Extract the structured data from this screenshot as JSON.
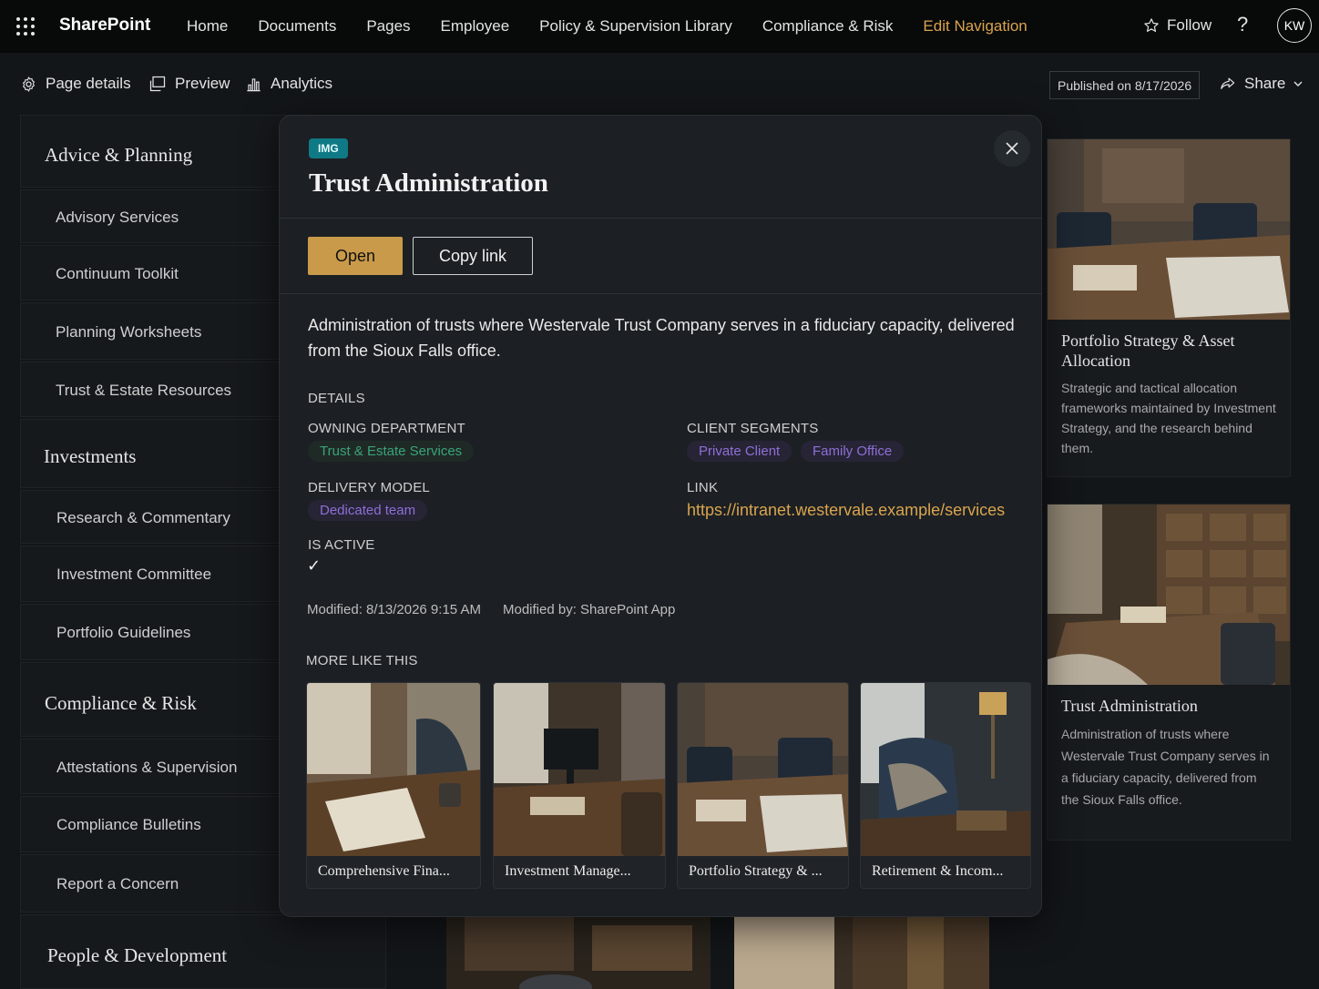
{
  "topbar": {
    "brand": "SharePoint",
    "nav": [
      "Home",
      "Documents",
      "Pages",
      "Employee",
      "Policy & Supervision Library",
      "Compliance & Risk"
    ],
    "edit_nav": "Edit Navigation",
    "follow": "Follow",
    "help": "?",
    "avatar": "KW"
  },
  "cmdbar": {
    "page_details": "Page details",
    "preview": "Preview",
    "analytics": "Analytics",
    "published": "Published on 8/17/2026",
    "share": "Share"
  },
  "leftnav": {
    "items": [
      {
        "label": "Advice & Planning",
        "type": "head"
      },
      {
        "label": "Advisory Services",
        "type": "sub"
      },
      {
        "label": "Continuum Toolkit",
        "type": "sub"
      },
      {
        "label": "Planning Worksheets",
        "type": "sub"
      },
      {
        "label": "Trust & Estate Resources",
        "type": "sub"
      },
      {
        "label": "Investments",
        "type": "head"
      },
      {
        "label": "Research & Commentary",
        "type": "sub"
      },
      {
        "label": "Investment Committee",
        "type": "sub"
      },
      {
        "label": "Portfolio Guidelines",
        "type": "sub"
      },
      {
        "label": "Compliance & Risk",
        "type": "head"
      },
      {
        "label": "Attestations & Supervision",
        "type": "sub"
      },
      {
        "label": "Compliance Bulletins",
        "type": "sub"
      },
      {
        "label": "Report a Concern",
        "type": "sub"
      },
      {
        "label": "People & Development",
        "type": "head"
      }
    ]
  },
  "cards": [
    {
      "title": "Portfolio Strategy & Asset Allocation",
      "body": "Strategic and tactical allocation frameworks maintained by Investment Strategy, and the research behind them."
    },
    {
      "title": "Trust Administration",
      "body": "Administration of trusts where Westervale Trust Company serves in a fiduciary capacity, delivered from the Sioux Falls office."
    }
  ],
  "modal": {
    "badge": "IMG",
    "title": "Trust Administration",
    "open": "Open",
    "copy_link": "Copy link",
    "description": "Administration of trusts where Westervale Trust Company serves in a fiduciary capacity, delivered from the Sioux Falls office.",
    "details_label": "DETAILS",
    "owning_dept_label": "OWNING DEPARTMENT",
    "owning_dept": "Trust & Estate Services",
    "client_segments_label": "CLIENT SEGMENTS",
    "client_segments": [
      "Private Client",
      "Family Office"
    ],
    "delivery_model_label": "DELIVERY MODEL",
    "delivery_model": "Dedicated team",
    "link_label": "LINK",
    "link": "https://intranet.westervale.example/services",
    "is_active_label": "IS ACTIVE",
    "is_active": "✓",
    "modified": "Modified: 8/13/2026 9:15 AM",
    "modified_by": "Modified by: SharePoint App",
    "more_label": "MORE LIKE THIS",
    "more": [
      "Comprehensive Fina...",
      "Investment Manage...",
      "Portfolio Strategy & ...",
      "Retirement & Incom..."
    ]
  },
  "colors": {
    "accent": "#d9a44e",
    "open_button": "#c99a4a",
    "badge": "#0f7a85",
    "pill_green": "#3aa37a",
    "pill_purple": "#8e6fd6"
  }
}
